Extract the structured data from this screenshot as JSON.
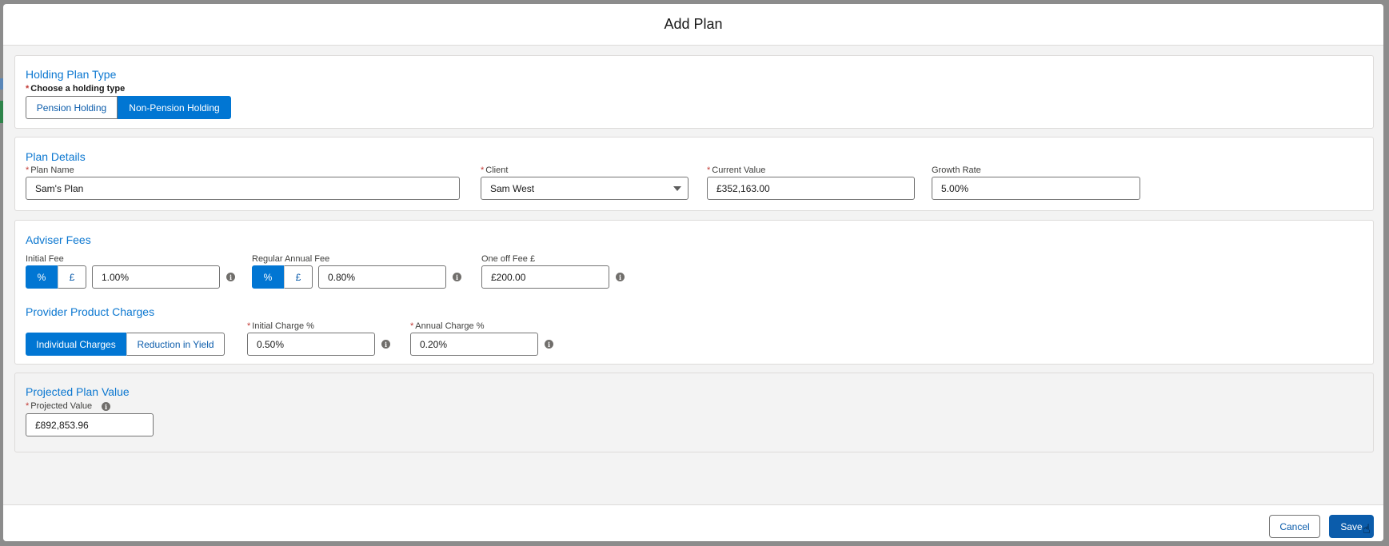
{
  "modal": {
    "title": "Add Plan"
  },
  "holding_plan_type": {
    "section_title": "Holding Plan Type",
    "required_mark": "*",
    "label": "Choose a holding type",
    "options": [
      "Pension Holding",
      "Non-Pension Holding"
    ],
    "selected": "Non-Pension Holding"
  },
  "plan_details": {
    "section_title": "Plan Details",
    "plan_name": {
      "label": "Plan Name",
      "value": "Sam's Plan"
    },
    "client": {
      "label": "Client",
      "value": "Sam West"
    },
    "current_value": {
      "label": "Current Value",
      "value": "£352,163.00"
    },
    "growth_rate": {
      "label": "Growth Rate",
      "value": "5.00%"
    }
  },
  "adviser_fees": {
    "section_title": "Adviser Fees",
    "initial_fee": {
      "label": "Initial Fee",
      "toggle": [
        "%",
        "£"
      ],
      "selected": "%",
      "value": "1.00%"
    },
    "regular_annual_fee": {
      "label": "Regular Annual Fee",
      "toggle": [
        "%",
        "£"
      ],
      "selected": "%",
      "value": "0.80%"
    },
    "one_off_fee": {
      "label": "One off Fee £",
      "value": "£200.00"
    }
  },
  "provider_product_charges": {
    "section_title": "Provider Product Charges",
    "options": [
      "Individual Charges",
      "Reduction in Yield"
    ],
    "selected": "Individual Charges",
    "initial_charge": {
      "label": "Initial Charge %",
      "value": "0.50%"
    },
    "annual_charge": {
      "label": "Annual Charge %",
      "value": "0.20%"
    }
  },
  "projected_plan_value": {
    "section_title": "Projected Plan Value",
    "projected_value": {
      "label": "Projected Value",
      "value": "£892,853.96"
    }
  },
  "footer": {
    "cancel_label": "Cancel",
    "save_label": "Save"
  },
  "colors": {
    "brand": "#0176d3",
    "section_title": "#0b77d0",
    "required": "#c23934"
  },
  "icons": {
    "info": "info-icon",
    "dropdown": "chevron-down-icon",
    "cursor": "hand-pointer-icon"
  }
}
